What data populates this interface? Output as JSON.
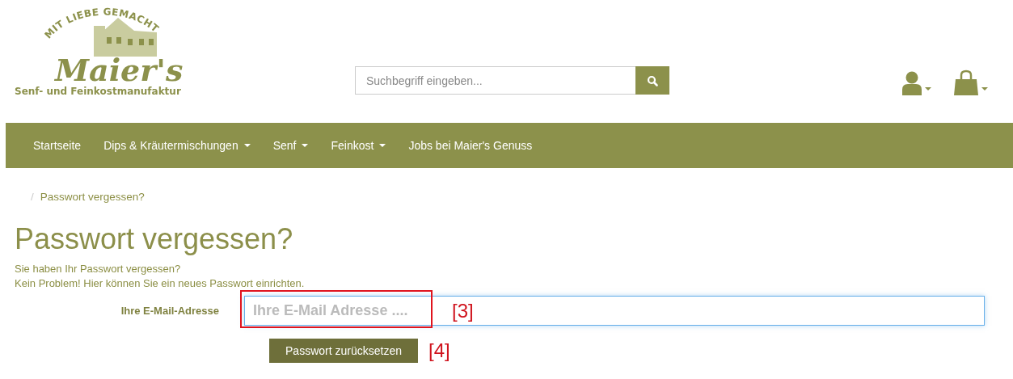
{
  "logo": {
    "arc_text": "MIT LIEBE GEMACHT",
    "brand": "Maier's",
    "tagline": "Senf- und Feinkostmanufaktur"
  },
  "search": {
    "placeholder": "Suchbegriff eingeben..."
  },
  "nav": [
    {
      "label": "Startseite",
      "dropdown": false
    },
    {
      "label": "Dips & Kräutermischungen",
      "dropdown": true
    },
    {
      "label": "Senf",
      "dropdown": true
    },
    {
      "label": "Feinkost",
      "dropdown": true
    },
    {
      "label": "Jobs bei Maier's Genuss",
      "dropdown": false
    }
  ],
  "breadcrumb": [
    {
      "separator": "/",
      "label": "Passwort vergessen?"
    }
  ],
  "heading": "Passwort vergessen?",
  "intro": [
    "Sie haben Ihr Passwort vergessen?",
    "Kein Problem! Hier können Sie ein neues Passwort einrichten."
  ],
  "form": {
    "label": "Ihre E-Mail-Adresse",
    "placeholder": "Ihre E-Mail Adresse ....",
    "button": "Passwort zurücksetzen",
    "field_note": {
      "label": "[3]",
      "boxed": true
    },
    "button_note": {
      "label": "[4]",
      "boxed": false
    }
  }
}
